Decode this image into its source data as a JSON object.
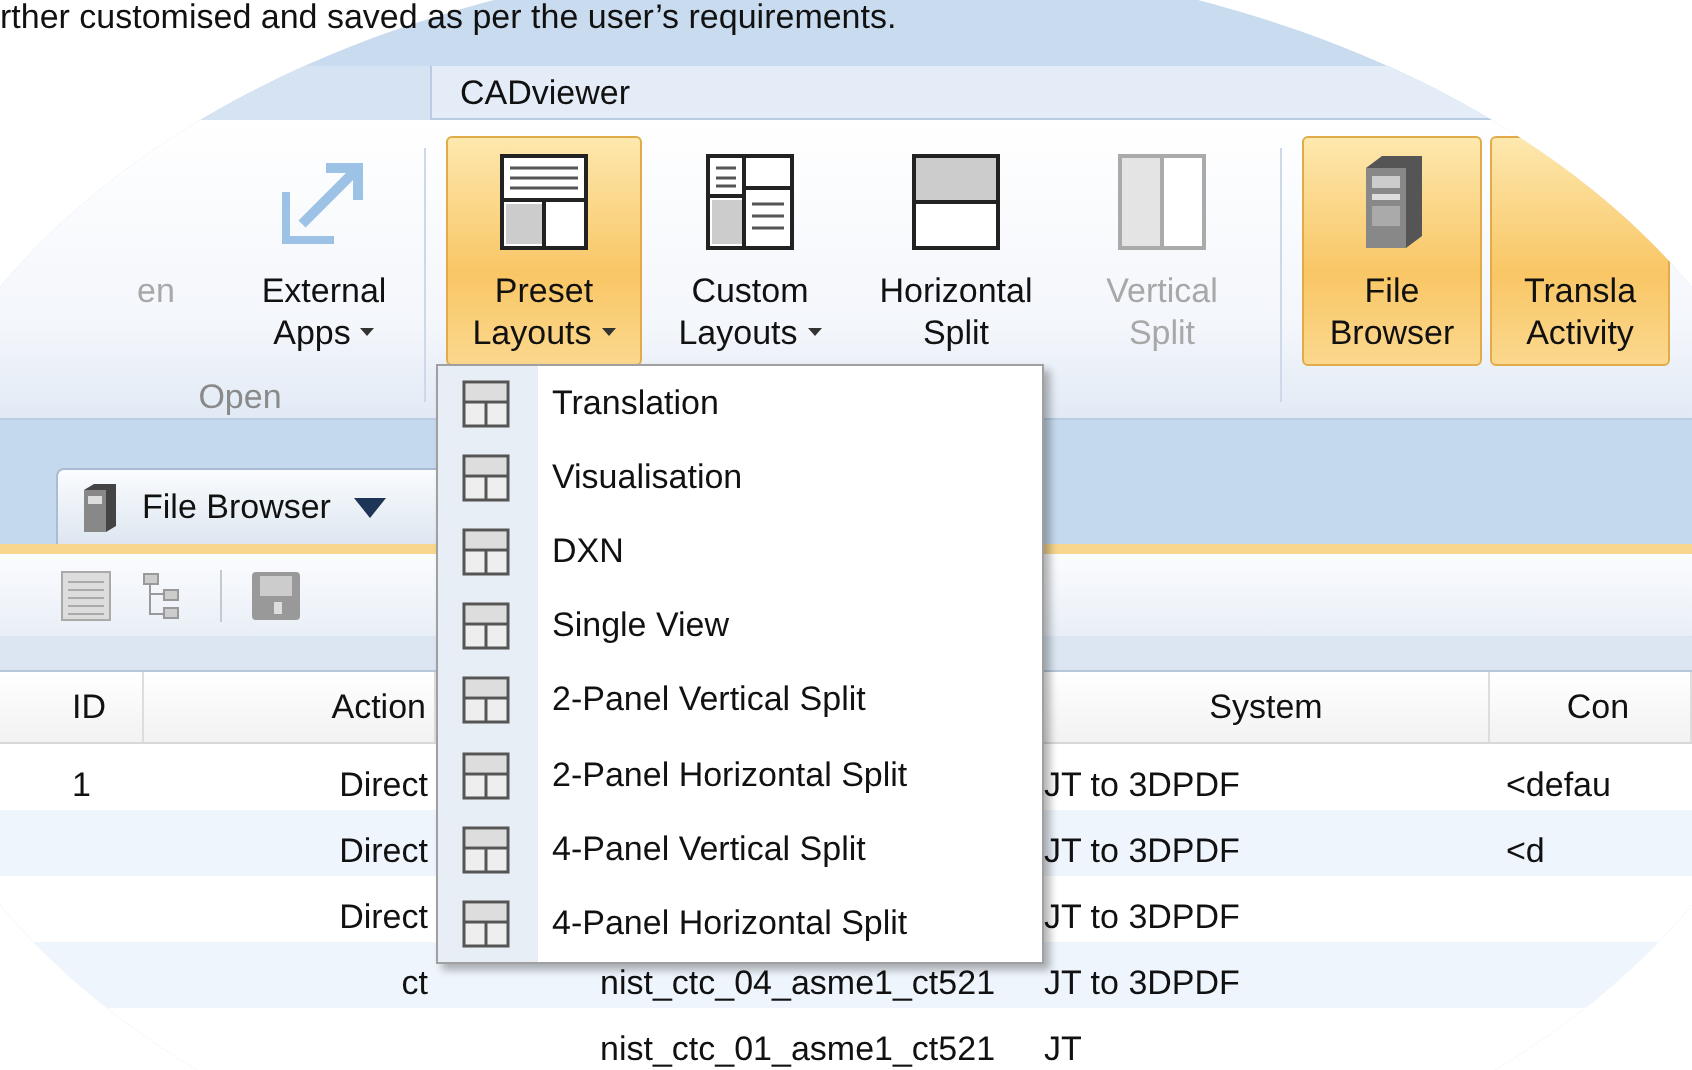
{
  "document_text": "rther customised and saved as per the user’s requirements.",
  "window": {
    "title": "CADviewer"
  },
  "ribbon": {
    "groups": [
      {
        "label": "Open",
        "buttons": [
          {
            "lines": [
              "en"
            ],
            "dropdown": false,
            "selected": false,
            "disabled": true
          },
          {
            "lines": [
              "External",
              "Apps"
            ],
            "dropdown": true,
            "selected": false,
            "disabled": false
          }
        ]
      },
      {
        "buttons": [
          {
            "lines": [
              "Preset",
              "Layouts"
            ],
            "dropdown": true,
            "selected": true,
            "disabled": false
          },
          {
            "lines": [
              "Custom",
              "Layouts"
            ],
            "dropdown": true,
            "selected": false,
            "disabled": false
          },
          {
            "lines": [
              "Horizontal",
              "Split"
            ],
            "dropdown": false,
            "selected": false,
            "disabled": false
          },
          {
            "lines": [
              "Vertical",
              "Split"
            ],
            "dropdown": false,
            "selected": false,
            "disabled": true
          }
        ]
      },
      {
        "buttons": [
          {
            "lines": [
              "File",
              "Browser"
            ],
            "dropdown": false,
            "selected": true,
            "disabled": false
          },
          {
            "lines": [
              "Transla",
              "Activity"
            ],
            "dropdown": false,
            "selected": true,
            "disabled": false
          }
        ]
      }
    ]
  },
  "pane_tab": {
    "label": "File Browser"
  },
  "dropdown_menu": {
    "items": [
      "Translation",
      "Visualisation",
      "DXN",
      "Single View",
      "2-Panel Vertical Split",
      "2-Panel Horizontal Split",
      "4-Panel Vertical Split",
      "4-Panel Horizontal Split"
    ]
  },
  "table": {
    "columns": {
      "id": "ID",
      "action": "Action",
      "system": "System",
      "column_5": "Con"
    },
    "rows": [
      {
        "id": "1",
        "action": "Direct",
        "system": "JT to 3DPDF",
        "column_5": "<defau"
      },
      {
        "action": "Direct",
        "system": "JT to 3DPDF",
        "column_5": "<d"
      },
      {
        "action": "Direct",
        "system": "JT to 3DPDF"
      },
      {
        "action": "ct",
        "column_3": "nist_ctc_04_asme1_ct521",
        "system": "JT to 3DPDF"
      },
      {
        "column_3": "nist_ctc_01_asme1_ct521",
        "system": "JT"
      }
    ]
  }
}
